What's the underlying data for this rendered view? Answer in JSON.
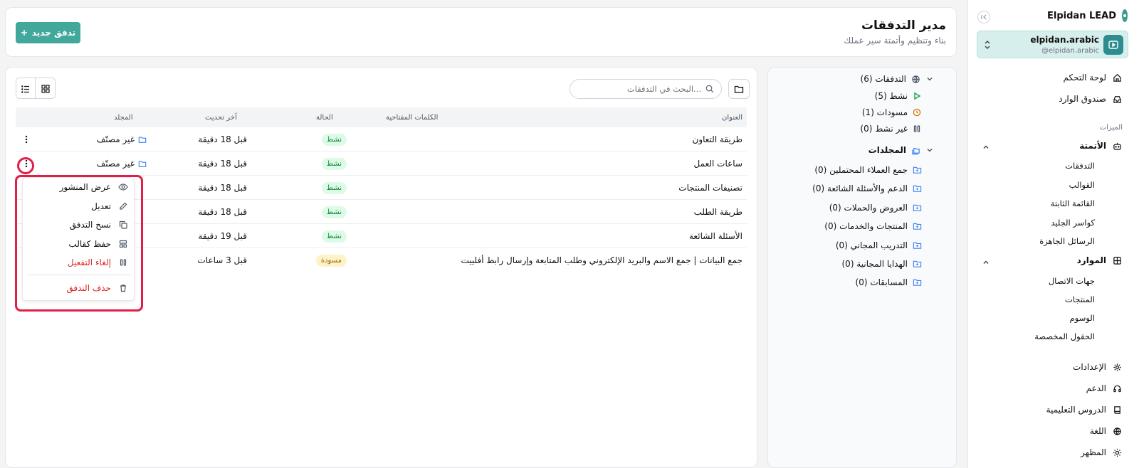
{
  "sidebar": {
    "brand": "Elpidan LEAD",
    "account": {
      "name": "elpidan.arabic",
      "handle": "@elpidan.arabic"
    },
    "nav_top": [
      {
        "label": "لوحة التحكم",
        "icon": "home-icon"
      },
      {
        "label": "صندوق الوارد",
        "icon": "inbox-icon"
      }
    ],
    "features_label": "الميزات",
    "automation": {
      "label": "الأتمتة",
      "icon": "bot-icon",
      "items": [
        "التدفقات",
        "القوالب",
        "القائمة الثابتة",
        "كواسر الجليد",
        "الرسائل الجاهزة"
      ]
    },
    "resources": {
      "label": "الموارد",
      "icon": "grid-icon",
      "items": [
        "جهات الاتصال",
        "المنتجات",
        "الوسوم",
        "الحقول المخصصة"
      ]
    },
    "nav_bottom": [
      {
        "label": "الإعدادات",
        "icon": "gear-icon"
      },
      {
        "label": "الدعم",
        "icon": "headset-icon"
      },
      {
        "label": "الدروس التعليمية",
        "icon": "book-icon"
      },
      {
        "label": "اللغة",
        "icon": "globe-icon"
      },
      {
        "label": "المظهر",
        "icon": "sun-icon"
      }
    ]
  },
  "header": {
    "title": "مدير التدفقات",
    "subtitle": "بناء وتنظيم وأتمتة سير عملك",
    "new_button": "تدفق جديد"
  },
  "folders": {
    "flows_root": "التدفقات (6)",
    "status_filters": [
      {
        "label": "نشط (5)",
        "icon": "play-icon",
        "color": "#16a34a"
      },
      {
        "label": "مسودات (1)",
        "icon": "clock-icon",
        "color": "#d97706"
      },
      {
        "label": "غير نشط (0)",
        "icon": "pause-icon",
        "color": "#4b5563"
      }
    ],
    "folders_root": "المجلدات",
    "folder_list": [
      "جمع العملاء المحتملين (0)",
      "الدعم والأسئلة الشائعة (0)",
      "العروض والحملات (0)",
      "المنتجات والخدمات (0)",
      "التدريب المجاني (0)",
      "الهدايا المجانية (0)",
      "المسابقات (0)"
    ]
  },
  "main": {
    "search_placeholder": "البحث في التدفقات...",
    "columns": {
      "title": "العنوان",
      "keywords": "الكلمات المفتاحية",
      "status": "الحالة",
      "updated": "آخر تحديث",
      "folder": "المجلد"
    },
    "rows": [
      {
        "title": "طريقة التعاون",
        "status": "نشط",
        "status_type": "active",
        "updated": "قبل 18 دقيقة",
        "folder": "غير مصنّف"
      },
      {
        "title": "ساعات العمل",
        "status": "نشط",
        "status_type": "active",
        "updated": "قبل 18 دقيقة",
        "folder": "غير مصنّف"
      },
      {
        "title": "تصنيفات المنتجات",
        "status": "نشط",
        "status_type": "active",
        "updated": "قبل 18 دقيقة",
        "folder": ""
      },
      {
        "title": "طريقة الطلب",
        "status": "نشط",
        "status_type": "active",
        "updated": "قبل 18 دقيقة",
        "folder": ""
      },
      {
        "title": "الأسئلة الشائعة",
        "status": "نشط",
        "status_type": "active",
        "updated": "قبل 19 دقيقة",
        "folder": ""
      },
      {
        "title": "جمع البيانات | جمع الاسم والبريد الإلكتروني وطلب المتابعة وإرسال رابط أفلييت",
        "status": "مسودة",
        "status_type": "draft",
        "updated": "قبل 3 ساعات",
        "folder": ""
      }
    ]
  },
  "context_menu": {
    "items": [
      {
        "label": "عرض المنشور",
        "icon": "eye-icon",
        "danger": false
      },
      {
        "label": "تعديل",
        "icon": "pencil-icon",
        "danger": false
      },
      {
        "label": "نسخ التدفق",
        "icon": "copy-icon",
        "danger": false
      },
      {
        "label": "حفظ كقالب",
        "icon": "template-icon",
        "danger": false
      },
      {
        "label": "إلغاء التفعيل",
        "icon": "pause-icon",
        "danger": true
      }
    ],
    "delete": {
      "label": "حذف التدفق",
      "icon": "trash-icon"
    }
  },
  "colors": {
    "accent": "#43a89c",
    "highlight": "#e11d48",
    "danger": "#dc2626"
  }
}
